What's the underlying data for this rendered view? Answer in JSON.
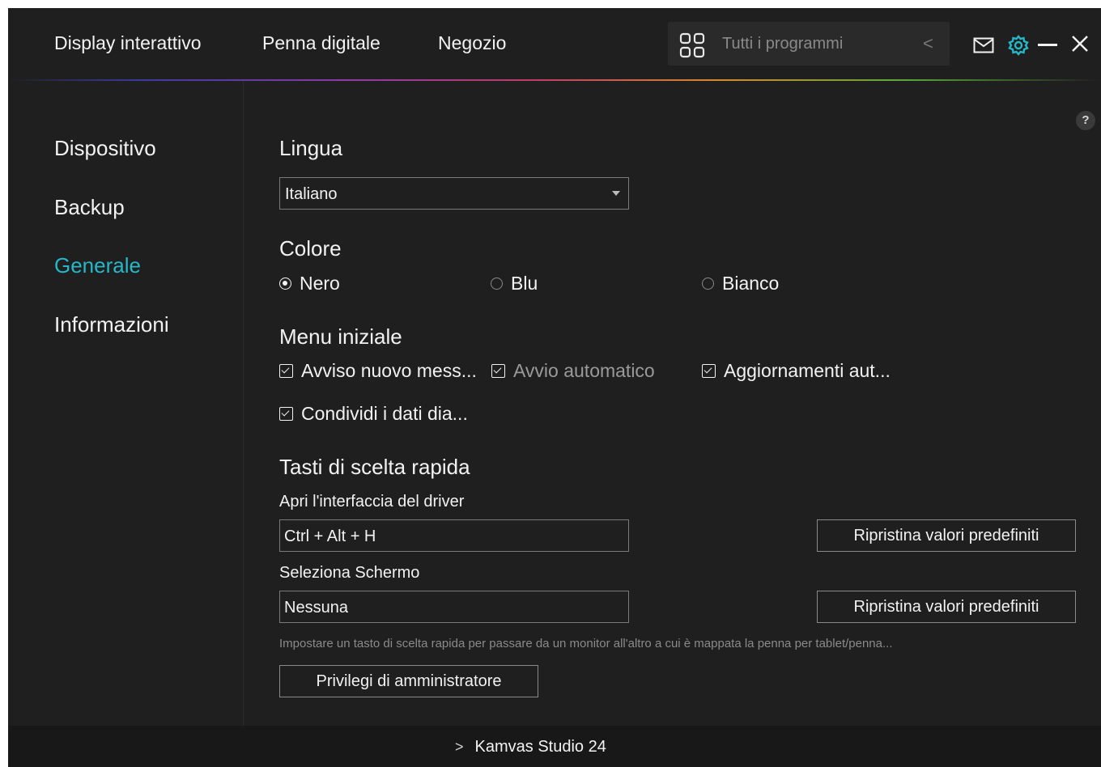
{
  "topbar": {
    "tabs": [
      {
        "label": "Display interattivo"
      },
      {
        "label": "Penna digitale"
      },
      {
        "label": "Negozio"
      }
    ],
    "program_select": {
      "placeholder": "Tutti i programmi",
      "icon": "grid-icon",
      "chevron": "<"
    },
    "icons": [
      "mail-icon",
      "gear-icon",
      "minimize-icon",
      "close-icon"
    ],
    "accent_color": "#26b8c8"
  },
  "sidebar": {
    "items": [
      {
        "label": "Dispositivo"
      },
      {
        "label": "Backup"
      },
      {
        "label": "Generale",
        "active": true
      },
      {
        "label": "Informazioni"
      }
    ]
  },
  "main": {
    "help": "?",
    "language": {
      "title": "Lingua",
      "value": "Italiano"
    },
    "color": {
      "title": "Colore",
      "options": [
        {
          "label": "Nero",
          "checked": true
        },
        {
          "label": "Blu",
          "checked": false
        },
        {
          "label": "Bianco",
          "checked": false
        }
      ]
    },
    "startup": {
      "title": "Menu iniziale",
      "options": [
        {
          "label": "Avviso nuovo mess...",
          "checked": true
        },
        {
          "label": "Avvio automatico",
          "checked": true
        },
        {
          "label": "Aggiornamenti aut...",
          "checked": true
        },
        {
          "label": "Condividi i dati dia...",
          "checked": true
        }
      ]
    },
    "shortcuts": {
      "title": "Tasti di scelta rapida",
      "items": [
        {
          "label": "Apri l'interfaccia del driver",
          "value": "Ctrl + Alt + H",
          "reset": "Ripristina valori predefiniti"
        },
        {
          "label": "Seleziona Schermo",
          "value": "Nessuna",
          "reset": "Ripristina valori predefiniti"
        }
      ],
      "hint": "Impostare un tasto di scelta rapida per passare da un monitor all'altro a cui è mappata la penna per tablet/penna...",
      "admin_button": "Privilegi di amministratore"
    }
  },
  "footer": {
    "device": "Kamvas Studio 24"
  }
}
